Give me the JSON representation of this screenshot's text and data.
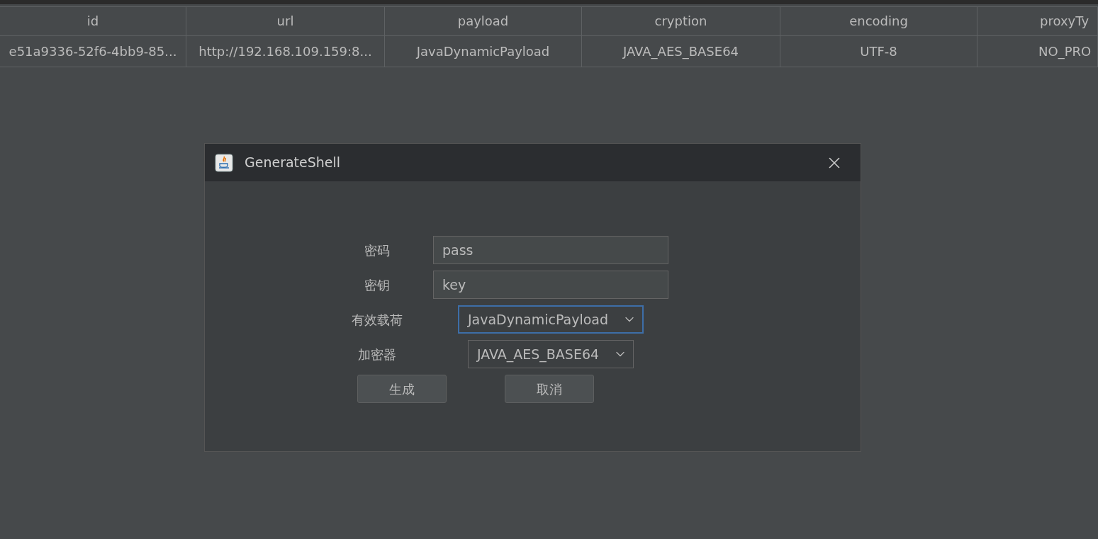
{
  "table": {
    "columns": [
      "id",
      "url",
      "payload",
      "cryption",
      "encoding",
      "proxyTy"
    ],
    "rows": [
      [
        "e51a9336-52f6-4bb9-85...",
        "http://192.168.109.159:8...",
        "JavaDynamicPayload",
        "JAVA_AES_BASE64",
        "UTF-8",
        "NO_PRO"
      ]
    ]
  },
  "dialog": {
    "title": "GenerateShell",
    "fields": [
      {
        "kind": "text",
        "label": "密码",
        "value": "pass",
        "focused": false
      },
      {
        "kind": "text",
        "label": "密钥",
        "value": "key",
        "focused": false
      },
      {
        "kind": "combo",
        "label": "有效载荷",
        "value": "JavaDynamicPayload",
        "focused": true
      },
      {
        "kind": "combo",
        "label": "加密器",
        "value": "JAVA_AES_BASE64",
        "focused": false
      }
    ],
    "buttons": [
      "生成",
      "取消"
    ]
  }
}
